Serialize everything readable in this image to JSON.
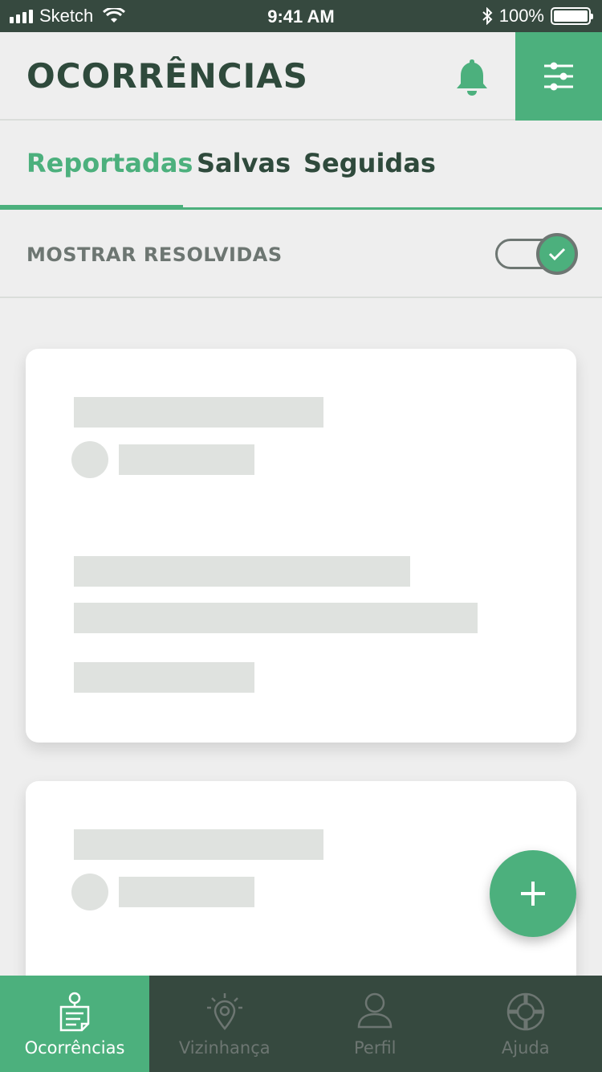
{
  "status_bar": {
    "carrier": "Sketch",
    "time": "9:41 AM",
    "battery": "100%"
  },
  "header": {
    "title": "OCORRÊNCIAS",
    "bell_icon": "bell-icon",
    "filter_icon": "sliders-icon"
  },
  "tabs": [
    {
      "label": "Reportadas",
      "active": true
    },
    {
      "label": "Salvas",
      "active": false
    },
    {
      "label": "Seguidas",
      "active": false
    }
  ],
  "filters": {
    "show_resolved_label": "MOSTRAR RESOLVIDAS",
    "show_resolved": true
  },
  "fab": {
    "icon": "plus-icon"
  },
  "bottom_nav": [
    {
      "label": "Ocorrências",
      "icon": "report-note-icon",
      "active": true
    },
    {
      "label": "Vizinhança",
      "icon": "location-pin-icon",
      "active": false
    },
    {
      "label": "Perfil",
      "icon": "user-icon",
      "active": false
    },
    {
      "label": "Ajuda",
      "icon": "lifebuoy-icon",
      "active": false
    }
  ],
  "colors": {
    "accent": "#4CB07D",
    "dark": "#36493F",
    "title": "#2F4A3C",
    "background": "#EEEEEE",
    "placeholder": "#DFE2DF",
    "muted": "#6D7672"
  }
}
